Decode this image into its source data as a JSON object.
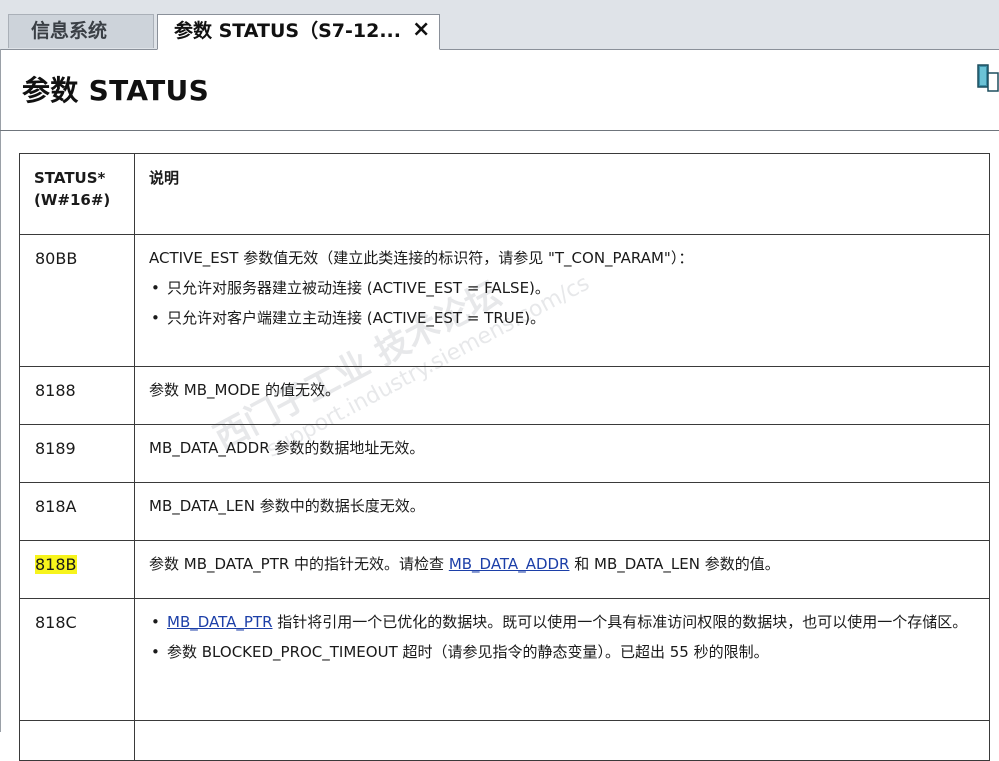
{
  "tabs": [
    {
      "label": "信息系统"
    },
    {
      "label": "参数 STATUS（S7-12..."
    }
  ],
  "tab_close_glyph": "×",
  "page": {
    "title": "参数 STATUS"
  },
  "table": {
    "header": {
      "col1_line1": "STATUS*",
      "col1_line2": "(W#16#)",
      "col2": "说明"
    },
    "rows": [
      {
        "code": "80BB",
        "desc": "ACTIVE_EST 参数值无效（建立此类连接的标识符，请参见 \"T_CON_PARAM\"）：",
        "bullets": [
          "只允许对服务器建立被动连接 (ACTIVE_EST = FALSE)。",
          "只允许对客户端建立主动连接 (ACTIVE_EST = TRUE)。"
        ]
      },
      {
        "code": "8188",
        "desc": "参数 MB_MODE 的值无效。"
      },
      {
        "code": "8189",
        "desc": "MB_DATA_ADDR 参数的数据地址无效。"
      },
      {
        "code": "818A",
        "desc": "MB_DATA_LEN 参数中的数据长度无效。"
      },
      {
        "code": "818B",
        "desc_pre": "参数 MB_DATA_PTR 中的指针无效。请检查 ",
        "desc_link": "MB_DATA_ADDR",
        "desc_post": " 和 MB_DATA_LEN 参数的值。"
      },
      {
        "code": "818C",
        "b1_link": "MB_DATA_PTR",
        "b1_text": " 指针将引用一个已优化的数据块。既可以使用一个具有标准访问权限的数据块，也可以使用一个存储区。",
        "b2_text": "参数 BLOCKED_PROC_TIMEOUT 超时（请参见指令的静态变量）。已超出 55 秒的限制。"
      }
    ]
  },
  "watermark": {
    "line1": "西门子工业 技术论坛",
    "line2": "support.industry.siemens.com/cs"
  }
}
